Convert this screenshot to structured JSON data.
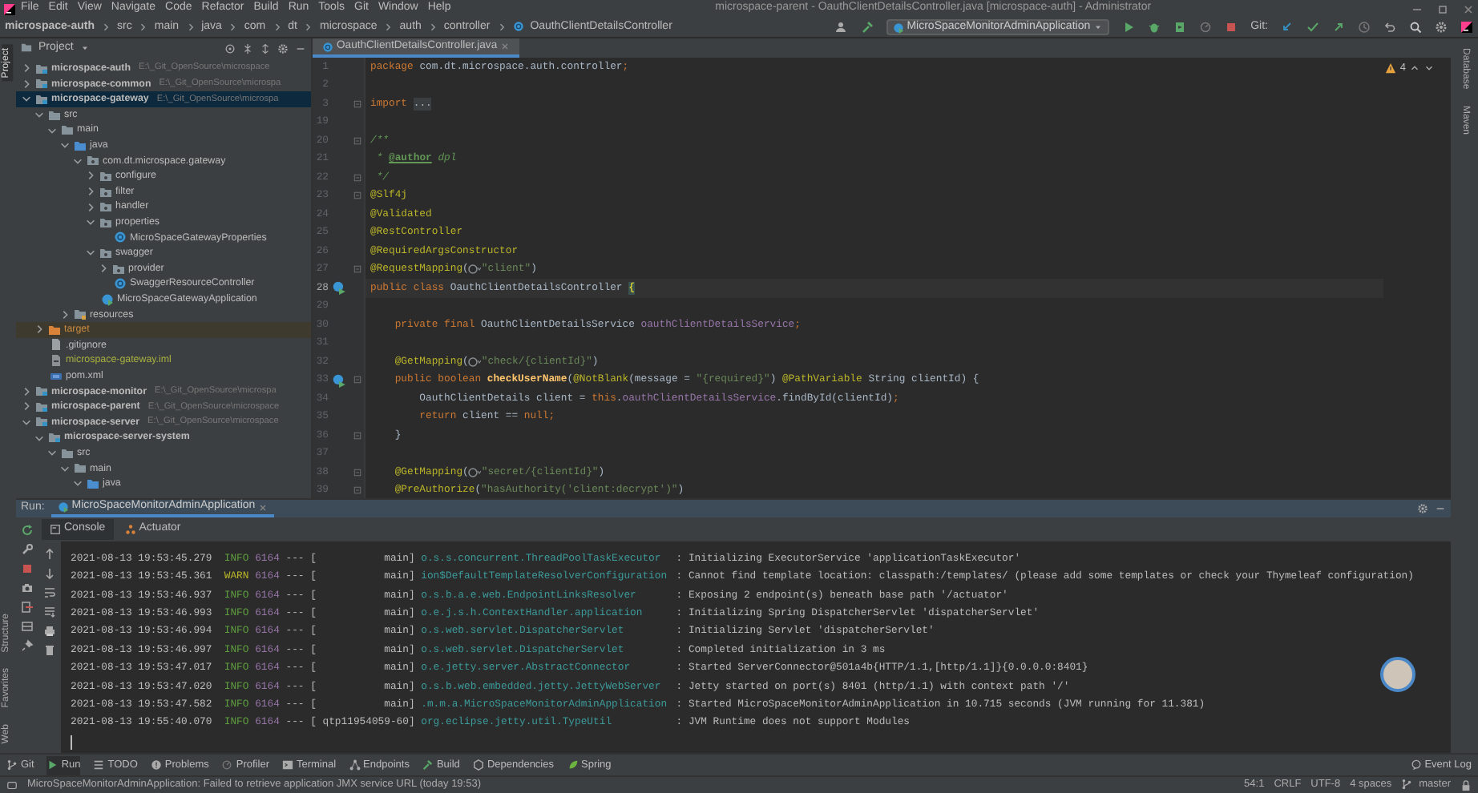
{
  "window": {
    "title": "microspace-parent - OauthClientDetailsController.java [microspace-auth] - Administrator"
  },
  "menu": [
    "File",
    "Edit",
    "View",
    "Navigate",
    "Code",
    "Refactor",
    "Build",
    "Run",
    "Tools",
    "Git",
    "Window",
    "Help"
  ],
  "breadcrumbs": [
    "microspace-auth",
    "src",
    "main",
    "java",
    "com",
    "dt",
    "microspace",
    "auth",
    "controller",
    "OauthClientDetailsController"
  ],
  "toolbar": {
    "run_configuration": "MicroSpaceMonitorAdminApplication",
    "git_label": "Git:"
  },
  "left_tool_windows_top": [
    {
      "label": "Project",
      "selected": true
    }
  ],
  "left_tool_windows_bottom": [
    {
      "label": "Structure",
      "selected": false
    },
    {
      "label": "Favorites",
      "selected": false
    },
    {
      "label": "Web",
      "selected": false
    }
  ],
  "right_tool_windows": [
    {
      "label": "Database",
      "selected": false
    },
    {
      "label": "Maven",
      "selected": false
    }
  ],
  "project": {
    "title": "Project",
    "tree": [
      {
        "label": "microspace-auth",
        "kind": "module",
        "path": "E:\\_Git_OpenSource\\microspace",
        "expanded": false,
        "selected": false
      },
      {
        "label": "microspace-common",
        "kind": "module",
        "path": "E:\\_Git_OpenSource\\microspa",
        "expanded": false,
        "selected": false
      },
      {
        "label": "microspace-gateway",
        "kind": "module",
        "path": "E:\\_Git_OpenSource\\microspa",
        "expanded": true,
        "selected": true,
        "children": [
          {
            "label": "src",
            "kind": "folder",
            "expanded": true,
            "selected": false,
            "children": [
              {
                "label": "main",
                "kind": "folder",
                "expanded": true,
                "selected": false,
                "children": [
                  {
                    "label": "java",
                    "kind": "source",
                    "expanded": true,
                    "selected": false,
                    "children": [
                      {
                        "label": "com.dt.microspace.gateway",
                        "kind": "package",
                        "expanded": true,
                        "selected": false,
                        "children": [
                          {
                            "label": "configure",
                            "kind": "package",
                            "expanded": false,
                            "selected": false
                          },
                          {
                            "label": "filter",
                            "kind": "package",
                            "expanded": false,
                            "selected": false
                          },
                          {
                            "label": "handler",
                            "kind": "package",
                            "expanded": false,
                            "selected": false
                          },
                          {
                            "label": "properties",
                            "kind": "package",
                            "expanded": true,
                            "selected": false,
                            "children": [
                              {
                                "label": "MicroSpaceGatewayProperties",
                                "kind": "class",
                                "selected": false
                              }
                            ]
                          },
                          {
                            "label": "swagger",
                            "kind": "package",
                            "expanded": true,
                            "selected": false,
                            "children": [
                              {
                                "label": "provider",
                                "kind": "package",
                                "expanded": false,
                                "selected": false
                              },
                              {
                                "label": "SwaggerResourceController",
                                "kind": "class",
                                "selected": false
                              }
                            ]
                          },
                          {
                            "label": "MicroSpaceGatewayApplication",
                            "kind": "app",
                            "selected": false
                          }
                        ]
                      }
                    ]
                  },
                  {
                    "label": "resources",
                    "kind": "resources",
                    "expanded": false,
                    "selected": false
                  }
                ]
              }
            ]
          },
          {
            "label": "target",
            "kind": "excluded",
            "expanded": false,
            "selected": false
          },
          {
            "label": ".gitignore",
            "kind": "file",
            "selected": false
          },
          {
            "label": "microspace-gateway.iml",
            "kind": "iml",
            "selected": false
          },
          {
            "label": "pom.xml",
            "kind": "pom",
            "selected": false
          }
        ]
      },
      {
        "label": "microspace-monitor",
        "kind": "module",
        "path": "E:\\_Git_OpenSource\\microspa",
        "expanded": false,
        "selected": false
      },
      {
        "label": "microspace-parent",
        "kind": "module",
        "path": "E:\\_Git_OpenSource\\microspace",
        "expanded": false,
        "selected": false
      },
      {
        "label": "microspace-server",
        "kind": "module",
        "path": "E:\\_Git_OpenSource\\microspace",
        "expanded": true,
        "selected": false,
        "children": [
          {
            "label": "microspace-server-system",
            "kind": "module",
            "expanded": true,
            "selected": false,
            "children": [
              {
                "label": "src",
                "kind": "folder",
                "expanded": true,
                "selected": false,
                "children": [
                  {
                    "label": "main",
                    "kind": "folder",
                    "expanded": true,
                    "selected": false,
                    "children": [
                      {
                        "label": "java",
                        "kind": "source",
                        "expanded": true,
                        "selected": false
                      }
                    ]
                  }
                ]
              }
            ]
          }
        ]
      }
    ]
  },
  "editor": {
    "tabs": [
      {
        "label": "OauthClientDetailsController.java",
        "selected": true
      }
    ],
    "inspection_count": "4",
    "lines": [
      {
        "number": "1",
        "current": false,
        "tokens": [
          {
            "kind": "keyword",
            "text": "package "
          },
          {
            "kind": "plain",
            "text": "com.dt.microspace.auth.controller"
          },
          {
            "kind": "keyword",
            "text": ";"
          }
        ]
      },
      {
        "number": "2",
        "current": false
      },
      {
        "number": "3",
        "current": false,
        "fold_marker": true,
        "tokens": [
          {
            "kind": "keyword",
            "text": "import "
          },
          {
            "kind": "folded",
            "text": "..."
          }
        ]
      },
      {
        "number": "19",
        "current": false
      },
      {
        "number": "20",
        "current": false,
        "fold_marker": true,
        "tokens": [
          {
            "kind": "comment",
            "text": "/**"
          }
        ]
      },
      {
        "number": "21",
        "current": false,
        "tokens": [
          {
            "kind": "comment",
            "text": " * "
          },
          {
            "kind": "doctag",
            "text": "@author"
          },
          {
            "kind": "comment",
            "text": " dpl"
          }
        ]
      },
      {
        "number": "22",
        "current": false,
        "fold_marker": true,
        "tokens": [
          {
            "kind": "comment",
            "text": " */"
          }
        ]
      },
      {
        "number": "23",
        "current": false,
        "fold_marker": true,
        "tokens": [
          {
            "kind": "annotation",
            "text": "@Slf4j"
          }
        ]
      },
      {
        "number": "24",
        "current": false,
        "tokens": [
          {
            "kind": "annotation",
            "text": "@Validated"
          }
        ]
      },
      {
        "number": "25",
        "current": false,
        "tokens": [
          {
            "kind": "annotation",
            "text": "@RestController"
          }
        ]
      },
      {
        "number": "26",
        "current": false,
        "tokens": [
          {
            "kind": "annotation",
            "text": "@RequiredArgsConstructor"
          }
        ]
      },
      {
        "number": "27",
        "current": false,
        "fold_marker": true,
        "tokens": [
          {
            "kind": "annotation",
            "text": "@RequestMapping"
          },
          {
            "kind": "plain",
            "text": "("
          },
          {
            "kind": "web-icon"
          },
          {
            "kind": "string",
            "text": "\"client\""
          },
          {
            "kind": "plain",
            "text": ")"
          }
        ]
      },
      {
        "number": "28",
        "current": true,
        "run_marker": true,
        "tokens": [
          {
            "kind": "keyword",
            "text": "public class "
          },
          {
            "kind": "plain",
            "text": "OauthClientDetailsController "
          },
          {
            "kind": "brace",
            "text": "{"
          }
        ]
      },
      {
        "number": "29",
        "current": false
      },
      {
        "number": "30",
        "current": false,
        "tokens": [
          {
            "kind": "keyword",
            "text": "    private final "
          },
          {
            "kind": "plain",
            "text": "OauthClientDetailsService "
          },
          {
            "kind": "field",
            "text": "oauthClientDetailsService"
          },
          {
            "kind": "keyword",
            "text": ";"
          }
        ]
      },
      {
        "number": "31",
        "current": false
      },
      {
        "number": "32",
        "current": false,
        "tokens": [
          {
            "kind": "annotation",
            "text": "    @GetMapping"
          },
          {
            "kind": "plain",
            "text": "("
          },
          {
            "kind": "web-icon"
          },
          {
            "kind": "string",
            "text": "\"check/{clientId}\""
          },
          {
            "kind": "plain",
            "text": ")"
          }
        ]
      },
      {
        "number": "33",
        "current": false,
        "run_marker": true,
        "fold_marker": true,
        "tokens": [
          {
            "kind": "keyword",
            "text": "    public boolean "
          },
          {
            "kind": "method",
            "text": "checkUserName"
          },
          {
            "kind": "plain",
            "text": "("
          },
          {
            "kind": "annotation",
            "text": "@NotBlank"
          },
          {
            "kind": "plain",
            "text": "(message = "
          },
          {
            "kind": "string",
            "text": "\"{required}\""
          },
          {
            "kind": "plain",
            "text": ") "
          },
          {
            "kind": "annotation",
            "text": "@PathVariable "
          },
          {
            "kind": "plain",
            "text": "String clientId) {"
          }
        ]
      },
      {
        "number": "34",
        "current": false,
        "tokens": [
          {
            "kind": "plain",
            "text": "        OauthClientDetails client = "
          },
          {
            "kind": "keyword",
            "text": "this"
          },
          {
            "kind": "plain",
            "text": "."
          },
          {
            "kind": "field",
            "text": "oauthClientDetailsService"
          },
          {
            "kind": "plain",
            "text": ".findById(clientId)"
          },
          {
            "kind": "keyword",
            "text": ";"
          }
        ]
      },
      {
        "number": "35",
        "current": false,
        "tokens": [
          {
            "kind": "keyword",
            "text": "        return "
          },
          {
            "kind": "plain",
            "text": "client == "
          },
          {
            "kind": "keyword",
            "text": "null;"
          }
        ]
      },
      {
        "number": "36",
        "current": false,
        "fold_marker": true,
        "tokens": [
          {
            "kind": "plain",
            "text": "    }"
          }
        ]
      },
      {
        "number": "37",
        "current": false
      },
      {
        "number": "38",
        "current": false,
        "fold_marker": true,
        "tokens": [
          {
            "kind": "annotation",
            "text": "    @GetMapping"
          },
          {
            "kind": "plain",
            "text": "("
          },
          {
            "kind": "web-icon"
          },
          {
            "kind": "string",
            "text": "\"secret/{clientId}\""
          },
          {
            "kind": "plain",
            "text": ")"
          }
        ]
      },
      {
        "number": "39",
        "current": false,
        "fold_marker": true,
        "tokens": [
          {
            "kind": "annotation",
            "text": "    @PreAuthorize"
          },
          {
            "kind": "plain",
            "text": "("
          },
          {
            "kind": "string",
            "text": "\"hasAuthority('client:decrypt')\""
          },
          {
            "kind": "plain",
            "text": ")"
          }
        ]
      }
    ]
  },
  "run": {
    "label": "Run:",
    "tabs": [
      {
        "label": "MicroSpaceMonitorAdminApplication",
        "selected": true
      }
    ],
    "subtabs": [
      {
        "label": "Console",
        "kind": "console",
        "selected": true
      },
      {
        "label": "Actuator",
        "kind": "actuator",
        "selected": false
      }
    ],
    "log": [
      {
        "time": "2021-08-13 19:53:45.279",
        "level": "INFO",
        "kind": "info",
        "pid": "6164",
        "separator": "---",
        "thread": "[           main]",
        "logger": "o.s.s.concurrent.ThreadPoolTaskExecutor",
        "message": ": Initializing ExecutorService 'applicationTaskExecutor'"
      },
      {
        "time": "2021-08-13 19:53:45.361",
        "level": "WARN",
        "kind": "warn",
        "pid": "6164",
        "separator": "---",
        "thread": "[           main]",
        "logger": "ion$DefaultTemplateResolverConfiguration",
        "message": ": Cannot find template location: classpath:/templates/ (please add some templates or check your Thymeleaf configuration)"
      },
      {
        "time": "2021-08-13 19:53:46.937",
        "level": "INFO",
        "kind": "info",
        "pid": "6164",
        "separator": "---",
        "thread": "[           main]",
        "logger": "o.s.b.a.e.web.EndpointLinksResolver",
        "message": ": Exposing 2 endpoint(s) beneath base path '/actuator'"
      },
      {
        "time": "2021-08-13 19:53:46.993",
        "level": "INFO",
        "kind": "info",
        "pid": "6164",
        "separator": "---",
        "thread": "[           main]",
        "logger": "o.e.j.s.h.ContextHandler.application",
        "message": ": Initializing Spring DispatcherServlet 'dispatcherServlet'"
      },
      {
        "time": "2021-08-13 19:53:46.994",
        "level": "INFO",
        "kind": "info",
        "pid": "6164",
        "separator": "---",
        "thread": "[           main]",
        "logger": "o.s.web.servlet.DispatcherServlet",
        "message": ": Initializing Servlet 'dispatcherServlet'"
      },
      {
        "time": "2021-08-13 19:53:46.997",
        "level": "INFO",
        "kind": "info",
        "pid": "6164",
        "separator": "---",
        "thread": "[           main]",
        "logger": "o.s.web.servlet.DispatcherServlet",
        "message": ": Completed initialization in 3 ms"
      },
      {
        "time": "2021-08-13 19:53:47.017",
        "level": "INFO",
        "kind": "info",
        "pid": "6164",
        "separator": "---",
        "thread": "[           main]",
        "logger": "o.e.jetty.server.AbstractConnector",
        "message": ": Started ServerConnector@501a4b{HTTP/1.1,[http/1.1]}{0.0.0.0:8401}"
      },
      {
        "time": "2021-08-13 19:53:47.020",
        "level": "INFO",
        "kind": "info",
        "pid": "6164",
        "separator": "---",
        "thread": "[           main]",
        "logger": "o.s.b.web.embedded.jetty.JettyWebServer",
        "message": ": Jetty started on port(s) 8401 (http/1.1) with context path '/'"
      },
      {
        "time": "2021-08-13 19:53:47.582",
        "level": "INFO",
        "kind": "info",
        "pid": "6164",
        "separator": "---",
        "thread": "[           main]",
        "logger": ".m.m.a.MicroSpaceMonitorAdminApplication",
        "message": ": Started MicroSpaceMonitorAdminApplication in 10.715 seconds (JVM running for 11.381)"
      },
      {
        "time": "2021-08-13 19:55:40.070",
        "level": "INFO",
        "kind": "info",
        "pid": "6164",
        "separator": "---",
        "thread": "[ qtp11954059-60]",
        "logger": "org.eclipse.jetty.util.TypeUtil",
        "message": ": JVM Runtime does not support Modules"
      }
    ]
  },
  "bottom_tools": [
    {
      "label": "Git",
      "kind": "git",
      "selected": false
    },
    {
      "label": "Run",
      "kind": "run",
      "selected": true
    },
    {
      "label": "TODO",
      "kind": "todo",
      "selected": false
    },
    {
      "label": "Problems",
      "kind": "problems",
      "selected": false
    },
    {
      "label": "Profiler",
      "kind": "profiler",
      "selected": false
    },
    {
      "label": "Terminal",
      "kind": "terminal",
      "selected": false
    },
    {
      "label": "Endpoints",
      "kind": "endpoints",
      "selected": false
    },
    {
      "label": "Build",
      "kind": "build",
      "selected": false
    },
    {
      "label": "Dependencies",
      "kind": "dependencies",
      "selected": false
    },
    {
      "label": "Spring",
      "kind": "spring",
      "selected": false
    }
  ],
  "event_log": "Event Log",
  "status_bar": {
    "message": "MicroSpaceMonitorAdminApplication: Failed to retrieve application JMX service URL (today 19:53)",
    "position": "54:1",
    "line_separator": "CRLF",
    "encoding": "UTF-8",
    "indent": "4 spaces",
    "branch": "master"
  }
}
